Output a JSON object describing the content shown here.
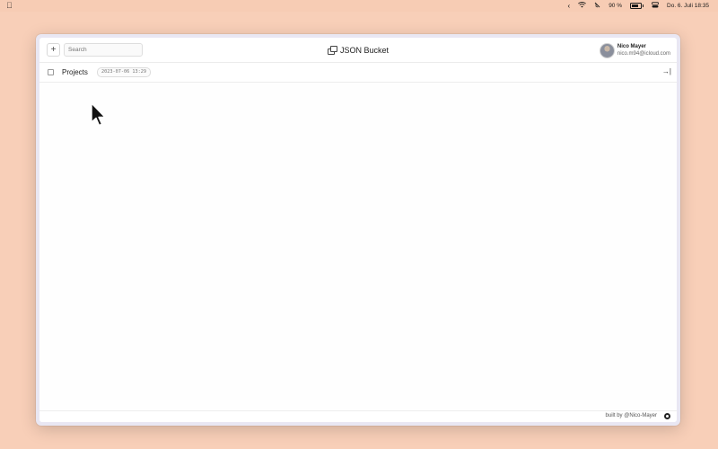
{
  "menubar": {
    "apple_icon": "apple-icon",
    "battery_percent": "90 %",
    "datetime": "Do. 6. Juli  18:35",
    "icons": [
      "chevron-left-icon",
      "wifi-icon",
      "mute-icon",
      "battery-icon",
      "control-center-icon"
    ]
  },
  "app": {
    "title": "JSON Bucket",
    "title_icon": "buckets-icon",
    "add_label": "+",
    "search": {
      "placeholder": "Search",
      "value": ""
    },
    "user": {
      "name": "Nico Mayer",
      "email": "nico.m94@icloud.com"
    }
  },
  "rows": [
    {
      "label": "Projects",
      "timestamp": "2023-07-06 13:29",
      "checked": false,
      "action_icon": "expand-right-icon",
      "action_label": "→|"
    }
  ],
  "footer": {
    "credit": "built by @Nico-Mayer",
    "icon": "github-icon"
  },
  "colors": {
    "desktop": "#f8cfb8",
    "window_frame": "#e9e7f3",
    "panel": "#ffffff"
  }
}
